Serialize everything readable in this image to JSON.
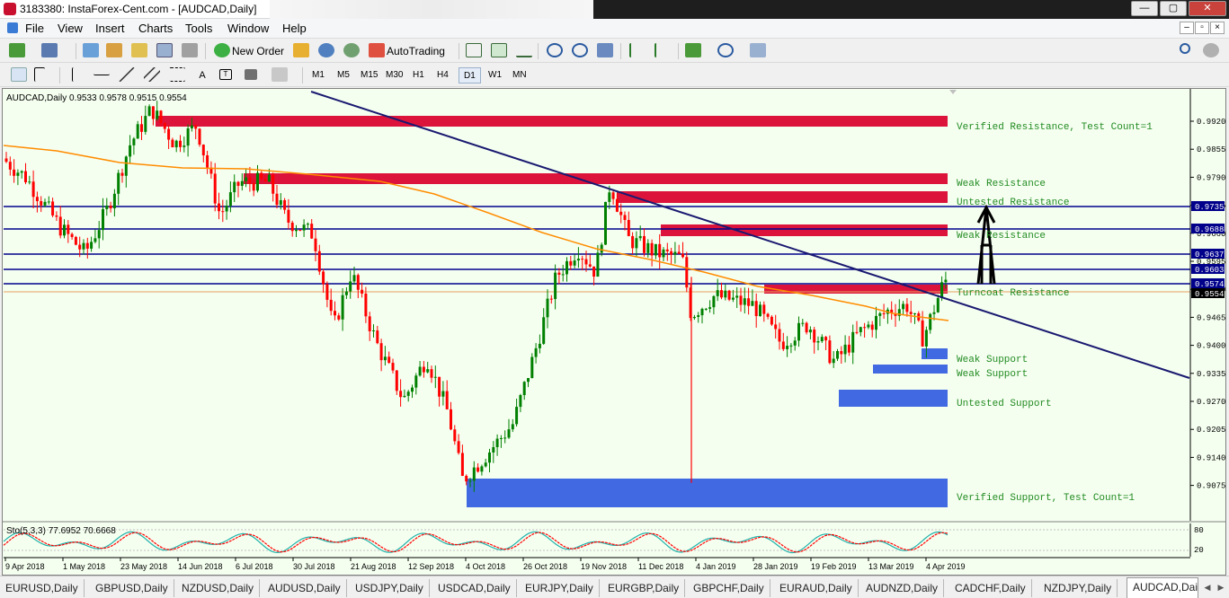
{
  "window": {
    "title": "3183380: InstaForex-Cent.com - [AUDCAD,Daily]",
    "min_btn": "—",
    "max_btn": "▢",
    "close_btn": "✕"
  },
  "menu": [
    "File",
    "View",
    "Insert",
    "Charts",
    "Tools",
    "Window",
    "Help"
  ],
  "toolbar": {
    "new_order_label": "New Order",
    "autotrading_label": "AutoTrading",
    "timeframes": [
      "M1",
      "M5",
      "M15",
      "M30",
      "H1",
      "H4",
      "D1",
      "W1",
      "MN"
    ],
    "active_timeframe": "D1"
  },
  "chart": {
    "header": "AUDCAD,Daily  0.9533 0.9578 0.9515 0.9554",
    "indicator_header": "Sto(5,3,3) 77.6952 70.6668",
    "indicator_axis": [
      "80",
      "20"
    ],
    "price_axis": [
      "0.9920",
      "0.9855",
      "0.9790",
      "0.9725",
      "0.9660",
      "0.9595",
      "0.9530",
      "0.9465",
      "0.9400",
      "0.9335",
      "0.9270",
      "0.9205",
      "0.9140",
      "0.9075"
    ],
    "level_labels": [
      "0.9735",
      "0.9688",
      "0.9637",
      "0.9603",
      "0.9574",
      "0.9554"
    ],
    "date_axis": [
      "9 Apr 2018",
      "1 May 2018",
      "23 May 2018",
      "14 Jun 2018",
      "6 Jul 2018",
      "30 Jul 2018",
      "21 Aug 2018",
      "12 Sep 2018",
      "4 Oct 2018",
      "26 Oct 2018",
      "19 Nov 2018",
      "11 Dec 2018",
      "4 Jan 2019",
      "28 Jan 2019",
      "19 Feb 2019",
      "13 Mar 2019",
      "4 Apr 2019"
    ],
    "zone_labels": [
      "Verified Resistance, Test Count=1",
      "Weak Resistance",
      "Untested Resistance",
      "Weak Resistance",
      "Turncoat Resistance",
      "Weak Support",
      "Weak Support",
      "Untested Support",
      "Verified Support, Test Count=1"
    ],
    "colors": {
      "background": "#f5fff0",
      "resistance": "#dc143c",
      "support": "#4169e1",
      "level_line": "#00008b",
      "trendline": "#191970",
      "moving_average": "#ff8c00",
      "bull_candle": "#008000",
      "bear_candle": "#ff0000",
      "zone_text": "#228b22"
    }
  },
  "tabs": [
    "EURUSD,Daily",
    "GBPUSD,Daily",
    "NZDUSD,Daily",
    "AUDUSD,Daily",
    "USDJPY,Daily",
    "USDCAD,Daily",
    "EURJPY,Daily",
    "EURGBP,Daily",
    "GBPCHF,Daily",
    "EURAUD,Daily",
    "AUDNZD,Daily",
    "CADCHF,Daily",
    "NZDJPY,Daily",
    "AUDCAD,Daily"
  ],
  "active_tab": "AUDCAD,Daily"
}
